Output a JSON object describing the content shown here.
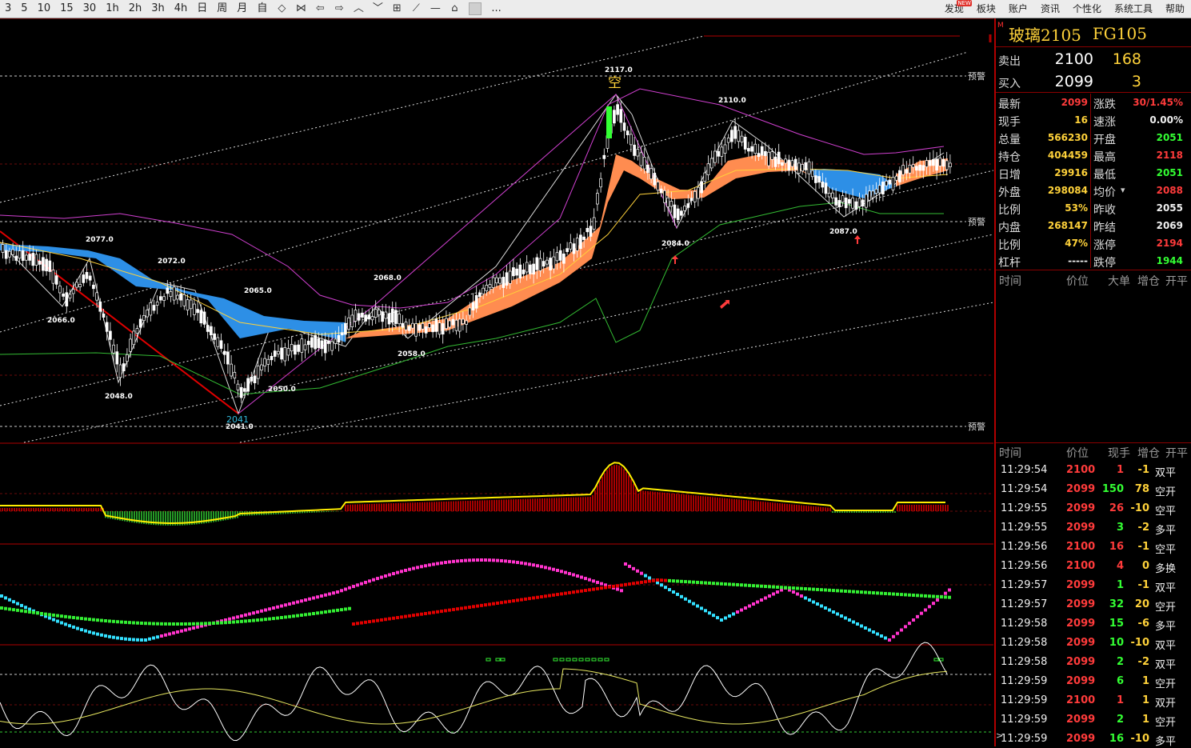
{
  "toolbar": {
    "periods": [
      "3",
      "5",
      "10",
      "15",
      "30",
      "1h",
      "2h",
      "3h",
      "4h",
      "日",
      "周",
      "月",
      "自"
    ],
    "right_menus": [
      "发现",
      "板块",
      "账户",
      "资讯",
      "个性化",
      "系统工具",
      "帮助"
    ],
    "new_badge": "NEW",
    "more": "..."
  },
  "colors": {
    "up": "#ff3b3b",
    "down": "#33ff33",
    "accent": "#ffd23a",
    "band_up": "#ff8c50",
    "band_down": "#2d8fe6",
    "frame": "#b00000"
  },
  "chart": {
    "warn_label": "预警",
    "price_labels": [
      {
        "text": "2117.0"
      },
      {
        "text": "2110.0"
      },
      {
        "text": "2077.0"
      },
      {
        "text": "2072.0"
      },
      {
        "text": "2065.0"
      },
      {
        "text": "2068.0"
      },
      {
        "text": "2066.0"
      },
      {
        "text": "2048.0"
      },
      {
        "text": "2050.0"
      },
      {
        "text": "2058.0"
      },
      {
        "text": "2041.0"
      },
      {
        "text": "2084.0"
      },
      {
        "text": "2087.0"
      }
    ],
    "low_marker": "2041",
    "high_marker": "空"
  },
  "panel": {
    "marker": "M",
    "name": "玻璃2105",
    "code": "FG105",
    "sell": {
      "label": "卖出",
      "price": "2100",
      "vol": "168"
    },
    "buy": {
      "label": "买入",
      "price": "2099",
      "vol": "3"
    },
    "stats_left": [
      {
        "k": "最新",
        "v": "2099",
        "c": "red"
      },
      {
        "k": "现手",
        "v": "16",
        "c": "yel"
      },
      {
        "k": "总量",
        "v": "566230",
        "c": "yel"
      },
      {
        "k": "持仓",
        "v": "404459",
        "c": "yel"
      },
      {
        "k": "日增",
        "v": "29916",
        "c": "yel"
      },
      {
        "k": "外盘",
        "v": "298084",
        "c": "yel"
      },
      {
        "k": "比例",
        "v": "53%",
        "c": "yel"
      },
      {
        "k": "内盘",
        "v": "268147",
        "c": "yel"
      },
      {
        "k": "比例",
        "v": "47%",
        "c": "yel"
      },
      {
        "k": "杠杆",
        "v": "-----",
        "c": "wht"
      }
    ],
    "stats_right": [
      {
        "k": "涨跌",
        "v": "30/1.45%",
        "c": "red"
      },
      {
        "k": "速涨",
        "v": "0.00%",
        "c": "wht"
      },
      {
        "k": "开盘",
        "v": "2051",
        "c": "green"
      },
      {
        "k": "最高",
        "v": "2118",
        "c": "red"
      },
      {
        "k": "最低",
        "v": "2051",
        "c": "green"
      },
      {
        "k": "均价",
        "v": "2088",
        "c": "red"
      },
      {
        "k": "昨收",
        "v": "2055",
        "c": "wht"
      },
      {
        "k": "昨结",
        "v": "2069",
        "c": "wht"
      },
      {
        "k": "涨停",
        "v": "2194",
        "c": "red"
      },
      {
        "k": "跌停",
        "v": "1944",
        "c": "green"
      }
    ],
    "big_order_headers": [
      "时间",
      "价位",
      "大单",
      "增仓",
      "开平"
    ],
    "tick_headers": [
      "时间",
      "价位",
      "现手",
      "增仓",
      "开平"
    ],
    "ticks": [
      {
        "t": "11:29:54",
        "p": "2100",
        "pc": "red",
        "v": "1",
        "vc": "red",
        "oi": "-1",
        "a": "双平"
      },
      {
        "t": "11:29:54",
        "p": "2099",
        "pc": "red",
        "v": "150",
        "vc": "green",
        "oi": "78",
        "a": "空开"
      },
      {
        "t": "11:29:55",
        "p": "2099",
        "pc": "red",
        "v": "26",
        "vc": "red",
        "oi": "-10",
        "a": "空平"
      },
      {
        "t": "11:29:55",
        "p": "2099",
        "pc": "red",
        "v": "3",
        "vc": "green",
        "oi": "-2",
        "a": "多平"
      },
      {
        "t": "11:29:56",
        "p": "2100",
        "pc": "red",
        "v": "16",
        "vc": "red",
        "oi": "-1",
        "a": "空平"
      },
      {
        "t": "11:29:56",
        "p": "2100",
        "pc": "red",
        "v": "4",
        "vc": "red",
        "oi": "0",
        "a": "多换"
      },
      {
        "t": "11:29:57",
        "p": "2099",
        "pc": "red",
        "v": "1",
        "vc": "green",
        "oi": "-1",
        "a": "双平"
      },
      {
        "t": "11:29:57",
        "p": "2099",
        "pc": "red",
        "v": "32",
        "vc": "green",
        "oi": "20",
        "a": "空开"
      },
      {
        "t": "11:29:58",
        "p": "2099",
        "pc": "red",
        "v": "15",
        "vc": "green",
        "oi": "-6",
        "a": "多平"
      },
      {
        "t": "11:29:58",
        "p": "2099",
        "pc": "red",
        "v": "10",
        "vc": "green",
        "oi": "-10",
        "a": "双平"
      },
      {
        "t": "11:29:58",
        "p": "2099",
        "pc": "red",
        "v": "2",
        "vc": "green",
        "oi": "-2",
        "a": "双平"
      },
      {
        "t": "11:29:59",
        "p": "2099",
        "pc": "red",
        "v": "6",
        "vc": "green",
        "oi": "1",
        "a": "空开"
      },
      {
        "t": "11:29:59",
        "p": "2100",
        "pc": "red",
        "v": "1",
        "vc": "red",
        "oi": "1",
        "a": "双开"
      },
      {
        "t": "11:29:59",
        "p": "2099",
        "pc": "red",
        "v": "2",
        "vc": "green",
        "oi": "1",
        "a": "空开"
      },
      {
        "t": "11:29:59",
        "p": "2099",
        "pc": "red",
        "v": "16",
        "vc": "green",
        "oi": "-10",
        "a": "多平"
      }
    ]
  }
}
